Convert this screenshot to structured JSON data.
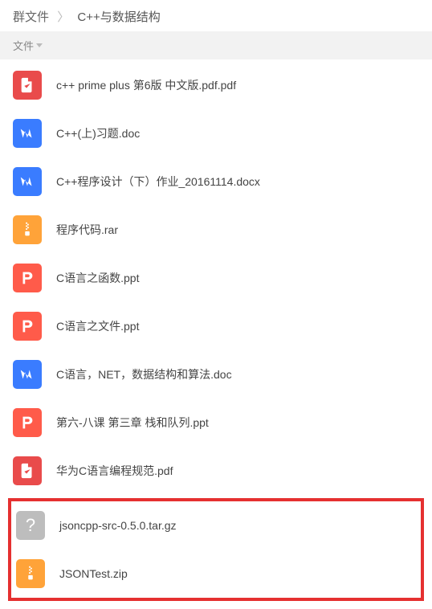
{
  "breadcrumb": {
    "root": "群文件",
    "separator": "〉",
    "current": "C++与数据结构"
  },
  "header": {
    "column_label": "文件"
  },
  "files": [
    {
      "name": "c++ prime plus 第6版 中文版.pdf.pdf",
      "type": "pdf"
    },
    {
      "name": "C++(上)习题.doc",
      "type": "doc"
    },
    {
      "name": "C++程序设计（下）作业_20161114.docx",
      "type": "doc"
    },
    {
      "name": "程序代码.rar",
      "type": "archive"
    },
    {
      "name": "C语言之函数.ppt",
      "type": "ppt"
    },
    {
      "name": "C语言之文件.ppt",
      "type": "ppt"
    },
    {
      "name": "C语言，NET，数据结构和算法.doc",
      "type": "doc"
    },
    {
      "name": "第六-八课 第三章 栈和队列.ppt",
      "type": "ppt"
    },
    {
      "name": "华为C语言编程规范.pdf",
      "type": "pdf"
    }
  ],
  "highlighted_files": [
    {
      "name": "jsoncpp-src-0.5.0.tar.gz",
      "type": "unknown"
    },
    {
      "name": "JSONTest.zip",
      "type": "archive"
    }
  ]
}
